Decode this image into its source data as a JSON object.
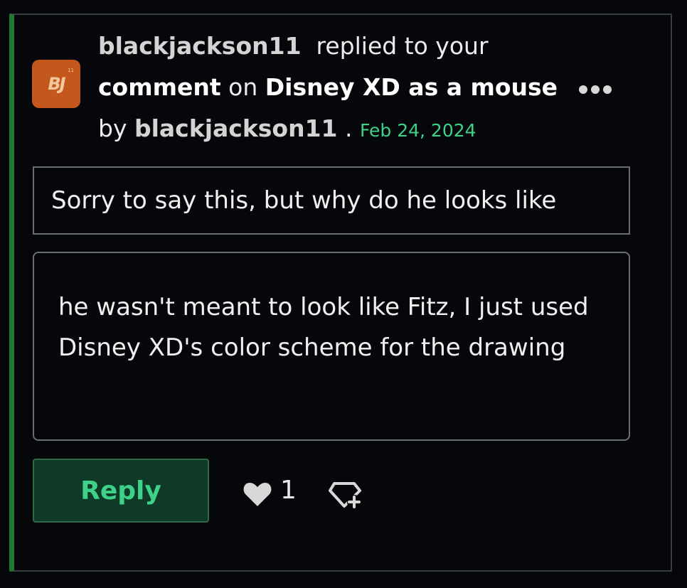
{
  "notification": {
    "actor": "blackjackson11",
    "action_text": "replied to your",
    "object_label": "comment",
    "on_text": "on",
    "post_title": "Disney XD as a mouse",
    "by_text": "by",
    "post_author": "blackjackson11",
    "separator": ".",
    "date": "Feb 24, 2024"
  },
  "avatar": {
    "initials": "BJ",
    "sup": "11",
    "color": "#c4571b"
  },
  "quoted_comment": {
    "text": "Sorry to say this, but why do he looks like"
  },
  "reply": {
    "text": "he wasn't meant to look like Fitz, I just used Disney XD's color scheme for the drawing"
  },
  "actions": {
    "reply_label": "Reply",
    "like_count": "1",
    "like_icon": "heart-icon",
    "share_icon": "favorite-add-icon"
  },
  "colors": {
    "accent_green": "#3fd08a",
    "border_left": "#1f7a2f",
    "background": "#06070b"
  }
}
